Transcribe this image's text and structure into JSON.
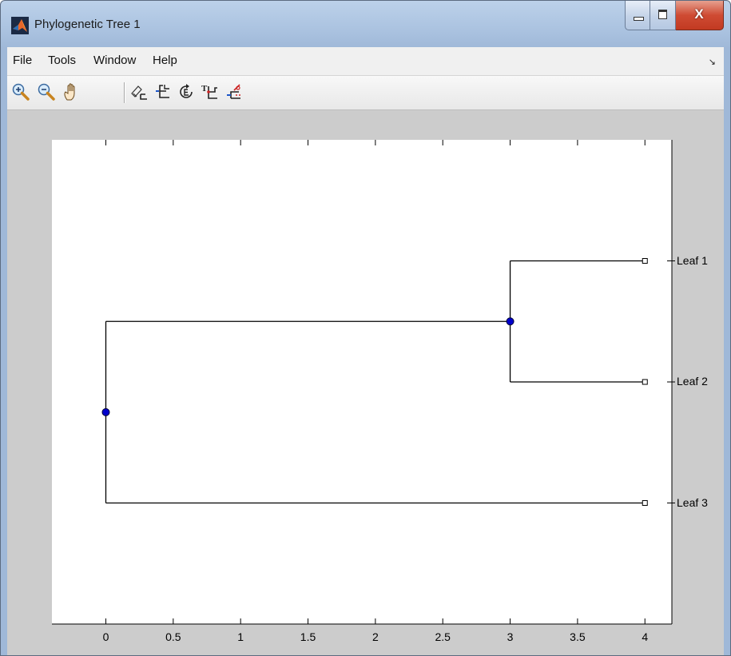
{
  "window": {
    "title": "Phylogenetic Tree 1",
    "icon": "matlab-logo-icon",
    "controls": [
      "minimize-icon",
      "maximize-icon",
      "close-icon"
    ],
    "close_glyph": "X"
  },
  "menubar": {
    "items": [
      {
        "label": "File"
      },
      {
        "label": "Tools"
      },
      {
        "label": "Window"
      },
      {
        "label": "Help"
      }
    ],
    "dock_arrow": "↘"
  },
  "toolbar": {
    "buttons": [
      "zoom-in-icon",
      "zoom-out-icon",
      "pan-hand-icon",
      "inspect-tools-icon",
      "collapse-expand-icon",
      "rotate-branch-icon",
      "rename-node-icon",
      "prune-icon"
    ]
  },
  "colors": {
    "node_fill": "#0000cc",
    "branch_line": "#000000",
    "figure_bg": "#cccccc",
    "axes_bg": "#ffffff"
  },
  "chart_data": {
    "type": "tree",
    "title": "",
    "xlabel": "",
    "ylabel": "",
    "xlim": [
      -0.4,
      4.2
    ],
    "x_ticks": [
      "0",
      "0.5",
      "1",
      "1.5",
      "2",
      "2.5",
      "3",
      "3.5",
      "4"
    ],
    "y_range": [
      0,
      4
    ],
    "leaves": [
      {
        "name": "Leaf 1",
        "x": 4,
        "y": 3
      },
      {
        "name": "Leaf 2",
        "x": 4,
        "y": 2
      },
      {
        "name": "Leaf 3",
        "x": 4,
        "y": 1
      }
    ],
    "branch_nodes": [
      {
        "x": 3,
        "y": 2.5,
        "children": [
          "Leaf 1",
          "Leaf 2"
        ]
      },
      {
        "x": 0,
        "y": 1.75,
        "children": [
          "branch-1",
          "Leaf 3"
        ]
      }
    ]
  }
}
